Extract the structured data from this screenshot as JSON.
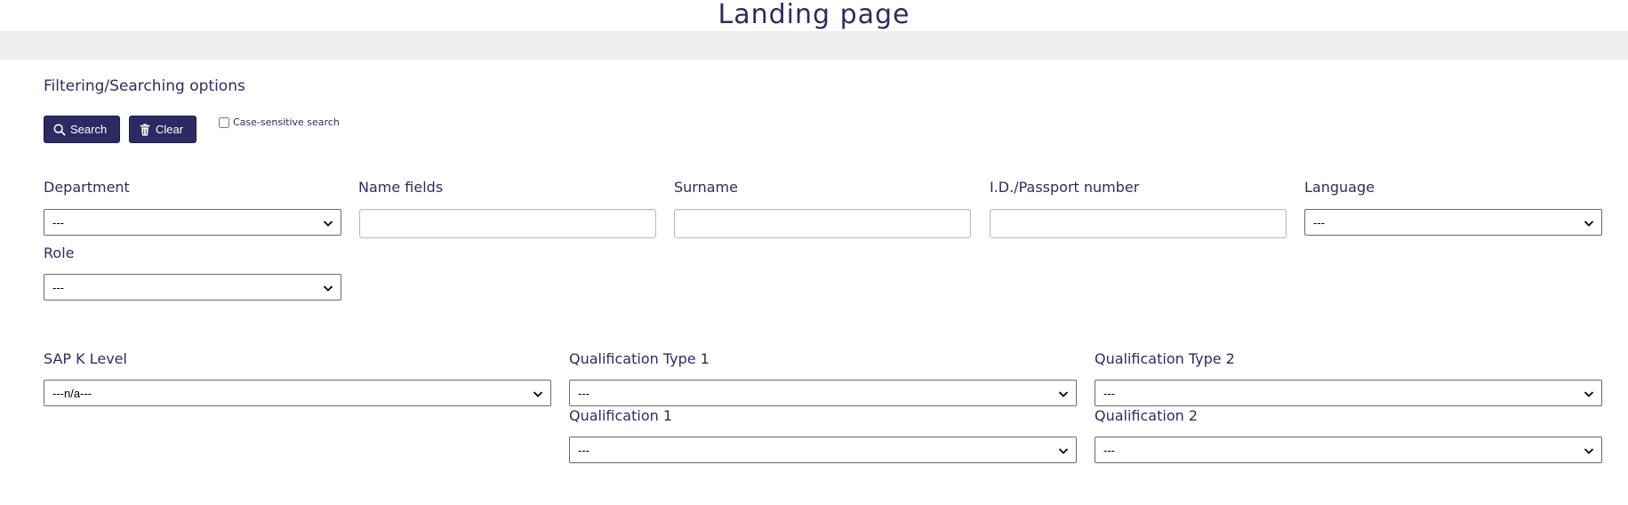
{
  "header": {
    "title": "Landing page"
  },
  "filters": {
    "heading": "Filtering/Searching options",
    "search_label": "Search",
    "clear_label": "Clear",
    "case_sensitive_label": "Case-sensitive search",
    "case_sensitive_checked": false,
    "department": {
      "label": "Department",
      "value": "---"
    },
    "name_fields": {
      "label": "Name fields",
      "value": ""
    },
    "surname": {
      "label": "Surname",
      "value": ""
    },
    "id_passport": {
      "label": "I.D./Passport number",
      "value": ""
    },
    "language": {
      "label": "Language",
      "value": "---"
    },
    "role": {
      "label": "Role",
      "value": "---"
    },
    "sap_k_level": {
      "label": "SAP K Level",
      "value": "---n/a---"
    },
    "qualification_type_1": {
      "label": "Qualification Type 1",
      "value": "---"
    },
    "qualification_type_2": {
      "label": "Qualification Type 2",
      "value": "---"
    },
    "qualification_1": {
      "label": "Qualification 1",
      "value": "---"
    },
    "qualification_2": {
      "label": "Qualification 2",
      "value": "---"
    }
  },
  "icons": {
    "search": "search-icon",
    "clear": "trash-icon",
    "dropdown": "chevron-down-icon"
  },
  "colors": {
    "brand": "#2d2c63",
    "button_bg": "#2b2a62",
    "page_bg": "#ededed",
    "panel_bg": "#ffffff"
  }
}
